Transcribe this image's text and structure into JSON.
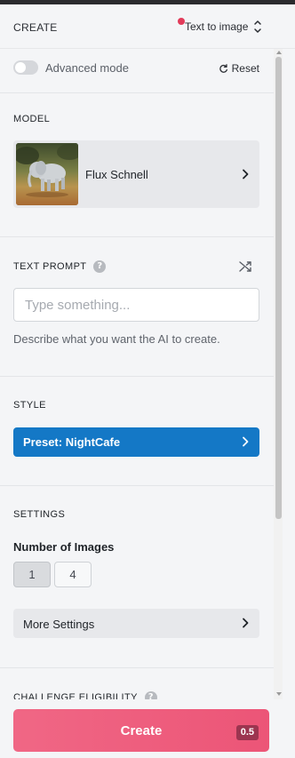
{
  "header": {
    "title": "CREATE",
    "mode_label": "Text to image"
  },
  "advanced": {
    "label": "Advanced mode",
    "enabled": false,
    "reset_label": "Reset"
  },
  "model": {
    "section_label": "MODEL",
    "name": "Flux Schnell",
    "thumbnail": "elephant-thumbnail"
  },
  "prompt": {
    "section_label": "TEXT PROMPT",
    "placeholder": "Type something...",
    "value": "",
    "help_text": "Describe what you want the AI to create."
  },
  "style": {
    "section_label": "STYLE",
    "preset_label": "Preset: NightCafe"
  },
  "settings": {
    "section_label": "SETTINGS",
    "num_images_title": "Number of Images",
    "options": [
      "1",
      "4"
    ],
    "selected": "1",
    "more_label": "More Settings"
  },
  "challenge": {
    "section_label": "CHALLENGE ELIGIBILITY"
  },
  "create": {
    "label": "Create",
    "cost": "0.5"
  },
  "colors": {
    "accent_pink": "#ec5577",
    "style_blue": "#1478c6",
    "notification_dot": "#e23b5a"
  }
}
